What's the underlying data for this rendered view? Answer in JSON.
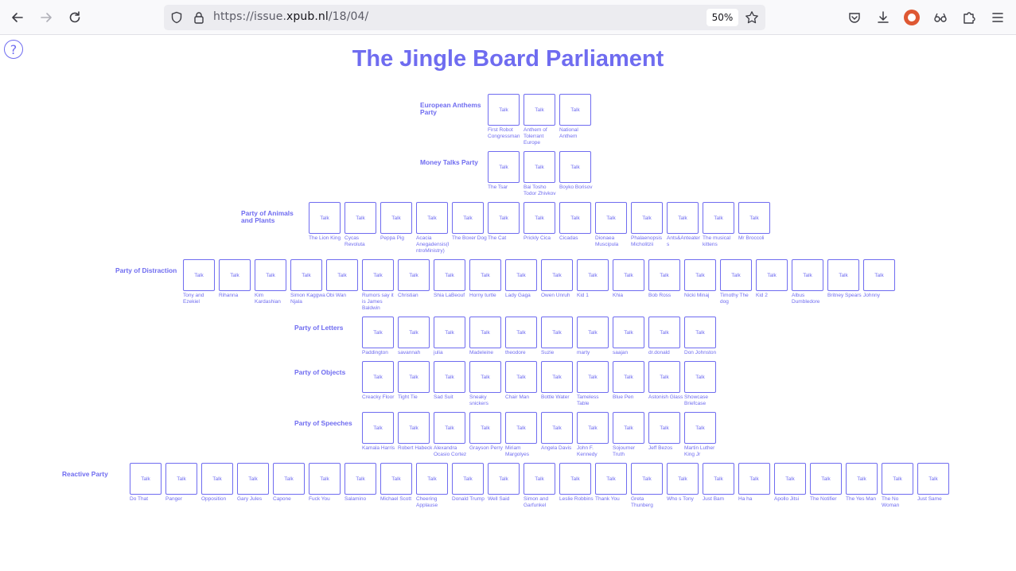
{
  "browser": {
    "url_prefix": "https://issue.",
    "url_host": "xpub.nl",
    "url_path": "/18/04/",
    "zoom": "50%"
  },
  "page": {
    "title": "The Jingle Board Parliament",
    "help_label": "?",
    "talk_label": "Talk"
  },
  "parties": [
    {
      "name": "European Anthems Party",
      "members": [
        "First Robot Congressman",
        "Anthem of Tolerrant Europe",
        "National Anthem"
      ]
    },
    {
      "name": "Money Talks Party",
      "members": [
        "The Tsar",
        "Bai Tosho Todor Zhivkov",
        "Boyko Borisov"
      ]
    },
    {
      "name": "Party of Animals and Plants",
      "members": [
        "The Lion King",
        "Cycas Revoluta",
        "Peppa Pig",
        "Acacia Anegadensis(I ntroMinistry)",
        "The Boxer Dog",
        "The Cat",
        "Prickly Cica",
        "Cicadas",
        "Dionaea Muscipula",
        "Phalaenopsis Micholitzii",
        "Ants&Anteater s",
        "The musical kittens",
        "Mr Broccoli"
      ]
    },
    {
      "name": "Party of Distraction",
      "members": [
        "Tony and Ezekiel",
        "Rihanna",
        "Kim Kardashian",
        "Simon Kaggwa Njala",
        "Obi Wan",
        "Rumors say it is James Baldwin",
        "Christian",
        "Shia LaBeouf",
        "Horny turtle",
        "Lady Gaga",
        "Owen Unruh",
        "Kid 1",
        "Khia",
        "Bob Ross",
        "Nicki Minaj",
        "Timothy The dog",
        "Kid 2",
        "Albus Dumbledore",
        "Britney Spears",
        "Johnny"
      ]
    },
    {
      "name": "Party of Letters",
      "members": [
        "Paddington",
        "savannah",
        "julia",
        "Madeleine",
        "theodore",
        "Suzie",
        "marty",
        "saajan",
        "dr.donald",
        "Don Johnston"
      ]
    },
    {
      "name": "Party of Objects",
      "members": [
        "Creacky Floor",
        "Tight Tie",
        "Sad Suit",
        "Sneaky snickers",
        "Chair Man",
        "Bottle Water",
        "Tameless Table",
        "Blue Pen",
        "Astonish Glass",
        "Showcase Briefcase"
      ]
    },
    {
      "name": "Party of Speeches",
      "members": [
        "Kamala Harris",
        "Robert Habeck",
        "Alexandra Ocasio Cortez",
        "Grayson Perry",
        "Miriam Margolyes",
        "Angela Davis",
        "John F. Kennedy",
        "Sojourner Truth",
        "Jeff Bezos",
        "Martin Luther King Jr"
      ]
    },
    {
      "name": "Reactive Party",
      "members": [
        "Do That",
        "Panger",
        "Opposition",
        "Gary Jules",
        "Capone",
        "Fuck You",
        "Salamino",
        "Michael Scott",
        "Cheering Applause",
        "Donald Trump",
        "Well Said",
        "Simon and Garfunkel",
        "Leslie Robbins",
        "Thank You",
        "Greta Thunberg",
        "Who s Tony",
        "Just Bam",
        "Ha ha",
        "Apollo Jitsi",
        "The Notifier",
        "The Yes Man",
        "The No Woman",
        "Just Same"
      ]
    }
  ]
}
